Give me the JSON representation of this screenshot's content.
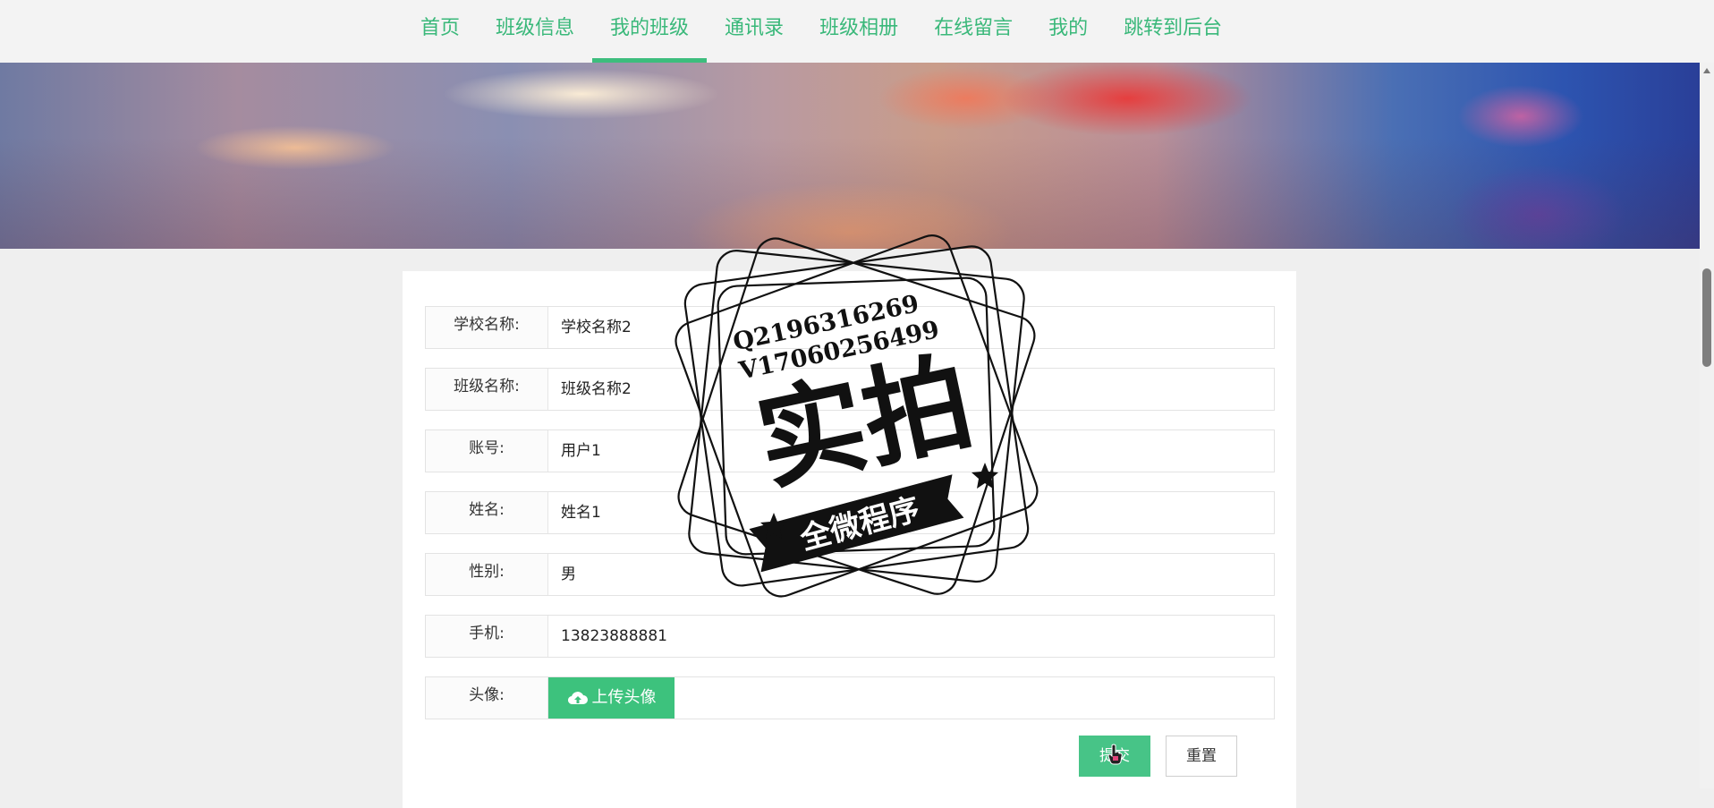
{
  "nav": {
    "items": [
      {
        "label": "首页",
        "active": false
      },
      {
        "label": "班级信息",
        "active": false
      },
      {
        "label": "我的班级",
        "active": true
      },
      {
        "label": "通讯录",
        "active": false
      },
      {
        "label": "班级相册",
        "active": false
      },
      {
        "label": "在线留言",
        "active": false
      },
      {
        "label": "我的",
        "active": false
      },
      {
        "label": "跳转到后台",
        "active": false
      }
    ],
    "accent_color": "#3dbd7d"
  },
  "form": {
    "fields": [
      {
        "label": "学校名称:",
        "value": "学校名称2"
      },
      {
        "label": "班级名称:",
        "value": "班级名称2"
      },
      {
        "label": "账号:",
        "value": "用户1"
      },
      {
        "label": "姓名:",
        "value": "姓名1"
      },
      {
        "label": "性别:",
        "value": "男"
      },
      {
        "label": "手机:",
        "value": "13823888881"
      }
    ],
    "avatar": {
      "label": "头像:",
      "upload_label": "上传头像",
      "icon": "cloud-upload-icon"
    },
    "submit_label": "提交",
    "reset_label": "重置"
  },
  "watermark": {
    "line1": "Q2196316269",
    "line2": "V17060256499",
    "main": "实拍",
    "ribbon": "全微程序"
  }
}
